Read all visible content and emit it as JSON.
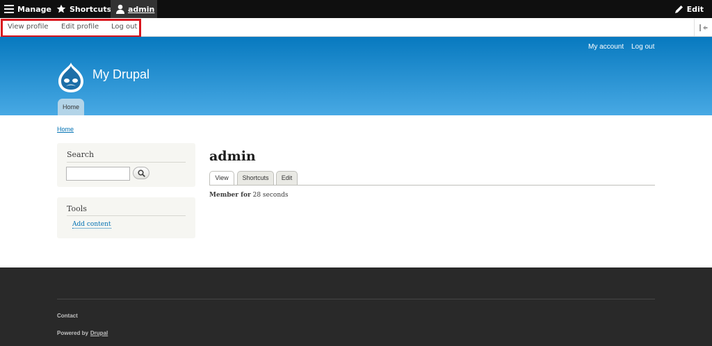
{
  "toolbar": {
    "manage_label": "Manage",
    "shortcuts_label": "Shortcuts",
    "user_label": "admin",
    "edit_label": "Edit"
  },
  "tray": {
    "view_profile": "View profile",
    "edit_profile": "Edit profile",
    "log_out": "Log out"
  },
  "header": {
    "my_account": "My account",
    "log_out": "Log out",
    "site_name": "My Drupal",
    "home_tab": "Home"
  },
  "breadcrumb": "Home",
  "sidebar": {
    "search_title": "Search",
    "search_value": "",
    "tools_title": "Tools",
    "add_content": "Add content"
  },
  "content": {
    "page_title": "admin",
    "tabs": [
      "View",
      "Shortcuts",
      "Edit"
    ],
    "member_label": "Member for",
    "member_value": "28 seconds"
  },
  "footer": {
    "contact": "Contact",
    "powered_by": "Powered by",
    "drupal_link": "Drupal"
  },
  "colors": {
    "toolbar": "#0f0f0f",
    "header_top": "#0779bf",
    "header_bottom": "#48a9e4",
    "link": "#0071b3",
    "highlight": "#d8141c",
    "footer": "#292929"
  }
}
